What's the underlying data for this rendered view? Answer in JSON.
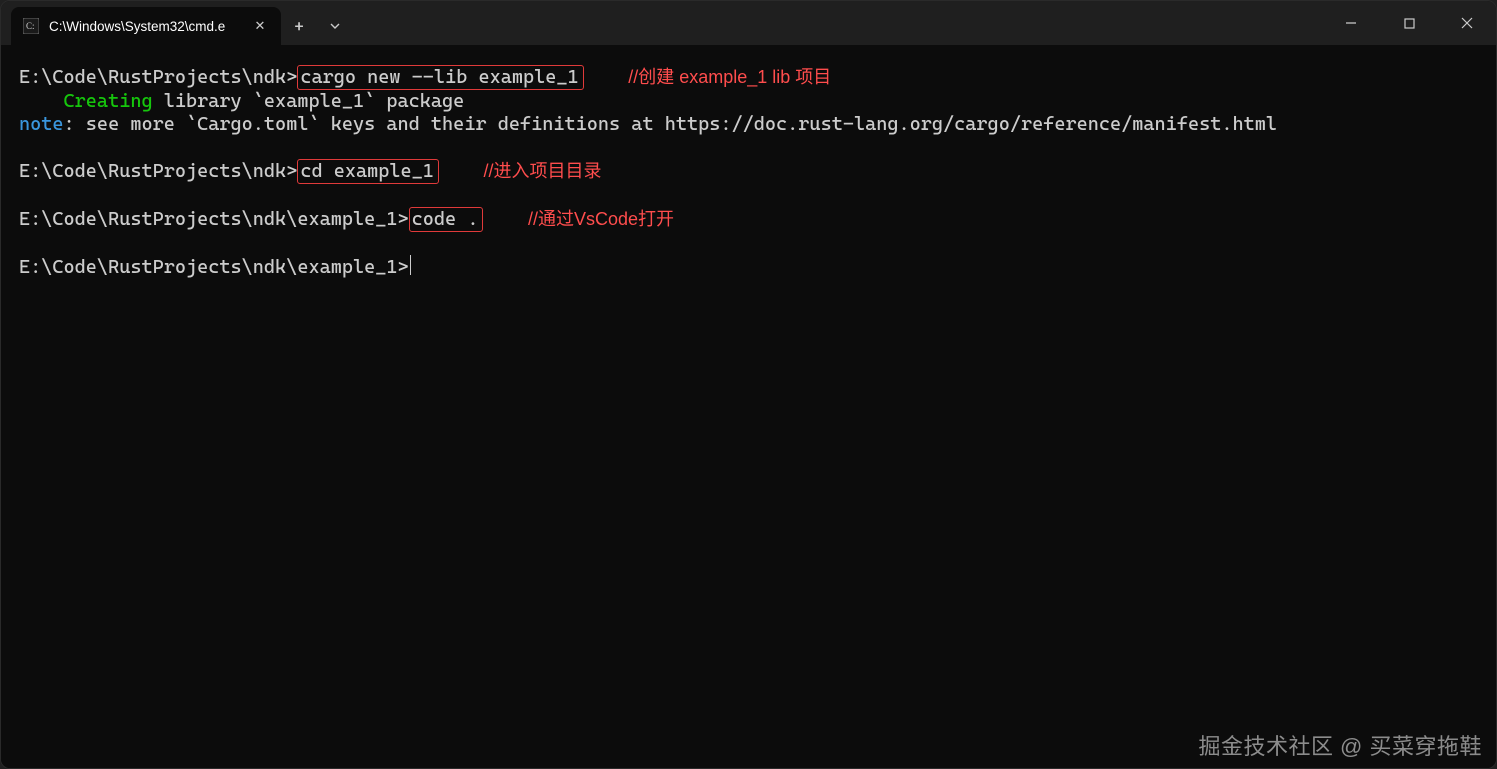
{
  "titlebar": {
    "tab_title": "C:\\Windows\\System32\\cmd.e",
    "tab_icon": "cmd-icon",
    "tab_close": "✕",
    "new_tab": "+",
    "dropdown": "⌄",
    "win_min": "—",
    "win_max": "▢",
    "win_close": "✕"
  },
  "terminal": {
    "lines": [
      {
        "prompt": "E:\\Code\\RustProjects\\ndk>",
        "cmd": "cargo new --lib example_1",
        "annot": "//创建 example_1 lib 项目"
      },
      {
        "indent": "    ",
        "green": "Creating",
        "rest": " library `example_1` package"
      },
      {
        "blue": "note",
        "rest": ": see more `Cargo.toml` keys and their definitions at https://doc.rust-lang.org/cargo/reference/manifest.html"
      },
      {
        "blank": " "
      },
      {
        "prompt": "E:\\Code\\RustProjects\\ndk>",
        "cmd": "cd example_1",
        "annot": "//进入项目目录"
      },
      {
        "blank": " "
      },
      {
        "prompt": "E:\\Code\\RustProjects\\ndk\\example_1>",
        "cmd": "code .",
        "annot": "//通过VsCode打开"
      },
      {
        "blank": " "
      },
      {
        "prompt": "E:\\Code\\RustProjects\\ndk\\example_1>",
        "cursor": true
      }
    ]
  },
  "watermark": "掘金技术社区 @ 买菜穿拖鞋"
}
